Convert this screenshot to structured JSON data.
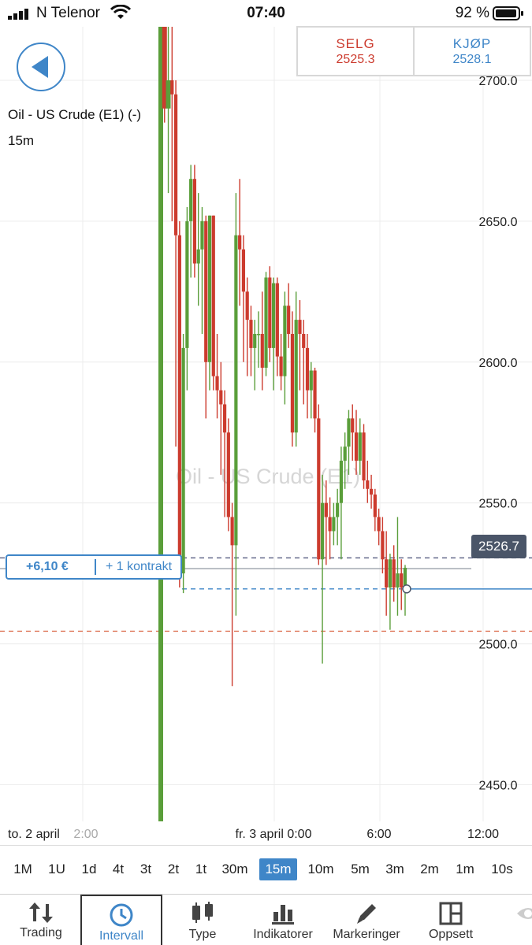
{
  "status_bar": {
    "carrier": "N Telenor",
    "time": "07:40",
    "battery_percent": "92 %"
  },
  "instrument": {
    "title": "Oil - US Crude (E1) (-)",
    "interval": "15m",
    "watermark": "Oil - US Crude (E1)"
  },
  "trade": {
    "sell_label": "SELG",
    "sell_price": "2525.3",
    "buy_label": "KJØP",
    "buy_price": "2528.1"
  },
  "position": {
    "pnl": "+6,10 €",
    "quantity": "+ 1 kontrakt"
  },
  "current_price_badge": "2526.7",
  "colors": {
    "accent": "#3f86c8",
    "up": "#5a9e3a",
    "down": "#cc3b2e",
    "badge": "#4a5568"
  },
  "chart_data": {
    "type": "candlestick",
    "y_ticks": [
      "2700.0",
      "2650.0",
      "2600.0",
      "2550.0",
      "2500.0",
      "2450.0"
    ],
    "y_tick_values": [
      2700,
      2650,
      2600,
      2550,
      2500,
      2450
    ],
    "x_labels": [
      "to. 2 april",
      "2:00",
      "fr. 3 april 0:00",
      "6:00",
      "12:00"
    ],
    "ylim": [
      2437,
      2719
    ],
    "reference_lines": {
      "current_price": 2526.7,
      "entry_price": 2519.5,
      "upper_dashed": 2530.5,
      "lower_dashed": 2504.5
    },
    "candles": [
      {
        "o": 2422,
        "h": 2719,
        "l": 2422,
        "c": 2719
      },
      {
        "o": 2719,
        "h": 2719,
        "l": 2685,
        "c": 2690
      },
      {
        "o": 2690,
        "h": 2719,
        "l": 2660,
        "c": 2700
      },
      {
        "o": 2700,
        "h": 2719,
        "l": 2650,
        "c": 2695
      },
      {
        "o": 2695,
        "h": 2700,
        "l": 2570,
        "c": 2645
      },
      {
        "o": 2645,
        "h": 2650,
        "l": 2520,
        "c": 2525
      },
      {
        "o": 2525,
        "h": 2610,
        "l": 2518,
        "c": 2605
      },
      {
        "o": 2605,
        "h": 2655,
        "l": 2590,
        "c": 2650
      },
      {
        "o": 2650,
        "h": 2670,
        "l": 2630,
        "c": 2665
      },
      {
        "o": 2665,
        "h": 2670,
        "l": 2630,
        "c": 2635
      },
      {
        "o": 2635,
        "h": 2660,
        "l": 2620,
        "c": 2640
      },
      {
        "o": 2640,
        "h": 2655,
        "l": 2610,
        "c": 2650
      },
      {
        "o": 2650,
        "h": 2652,
        "l": 2580,
        "c": 2600
      },
      {
        "o": 2600,
        "h": 2652,
        "l": 2590,
        "c": 2652
      },
      {
        "o": 2652,
        "h": 2652,
        "l": 2590,
        "c": 2595
      },
      {
        "o": 2595,
        "h": 2610,
        "l": 2580,
        "c": 2590
      },
      {
        "o": 2590,
        "h": 2600,
        "l": 2560,
        "c": 2585
      },
      {
        "o": 2585,
        "h": 2590,
        "l": 2545,
        "c": 2575
      },
      {
        "o": 2575,
        "h": 2580,
        "l": 2540,
        "c": 2545
      },
      {
        "o": 2545,
        "h": 2550,
        "l": 2485,
        "c": 2535
      },
      {
        "o": 2535,
        "h": 2660,
        "l": 2510,
        "c": 2645
      },
      {
        "o": 2645,
        "h": 2665,
        "l": 2620,
        "c": 2640
      },
      {
        "o": 2640,
        "h": 2645,
        "l": 2600,
        "c": 2625
      },
      {
        "o": 2625,
        "h": 2630,
        "l": 2595,
        "c": 2615
      },
      {
        "o": 2615,
        "h": 2620,
        "l": 2595,
        "c": 2605
      },
      {
        "o": 2605,
        "h": 2615,
        "l": 2590,
        "c": 2610
      },
      {
        "o": 2610,
        "h": 2618,
        "l": 2598,
        "c": 2610
      },
      {
        "o": 2610,
        "h": 2625,
        "l": 2590,
        "c": 2598
      },
      {
        "o": 2598,
        "h": 2632,
        "l": 2595,
        "c": 2630
      },
      {
        "o": 2630,
        "h": 2634,
        "l": 2600,
        "c": 2605
      },
      {
        "o": 2605,
        "h": 2630,
        "l": 2590,
        "c": 2628
      },
      {
        "o": 2628,
        "h": 2630,
        "l": 2595,
        "c": 2602
      },
      {
        "o": 2602,
        "h": 2610,
        "l": 2590,
        "c": 2595
      },
      {
        "o": 2595,
        "h": 2625,
        "l": 2585,
        "c": 2620
      },
      {
        "o": 2620,
        "h": 2628,
        "l": 2605,
        "c": 2610
      },
      {
        "o": 2610,
        "h": 2618,
        "l": 2570,
        "c": 2575
      },
      {
        "o": 2575,
        "h": 2625,
        "l": 2570,
        "c": 2615
      },
      {
        "o": 2615,
        "h": 2622,
        "l": 2590,
        "c": 2610
      },
      {
        "o": 2610,
        "h": 2615,
        "l": 2585,
        "c": 2605
      },
      {
        "o": 2605,
        "h": 2610,
        "l": 2580,
        "c": 2590
      },
      {
        "o": 2590,
        "h": 2600,
        "l": 2580,
        "c": 2597
      },
      {
        "o": 2597,
        "h": 2598,
        "l": 2575,
        "c": 2580
      },
      {
        "o": 2580,
        "h": 2585,
        "l": 2528,
        "c": 2530
      },
      {
        "o": 2530,
        "h": 2560,
        "l": 2493,
        "c": 2550
      },
      {
        "o": 2550,
        "h": 2558,
        "l": 2528,
        "c": 2545
      },
      {
        "o": 2545,
        "h": 2552,
        "l": 2530,
        "c": 2540
      },
      {
        "o": 2540,
        "h": 2550,
        "l": 2535,
        "c": 2545
      },
      {
        "o": 2545,
        "h": 2555,
        "l": 2535,
        "c": 2550
      },
      {
        "o": 2550,
        "h": 2570,
        "l": 2530,
        "c": 2565
      },
      {
        "o": 2565,
        "h": 2575,
        "l": 2555,
        "c": 2570
      },
      {
        "o": 2570,
        "h": 2583,
        "l": 2560,
        "c": 2580
      },
      {
        "o": 2580,
        "h": 2585,
        "l": 2565,
        "c": 2575
      },
      {
        "o": 2575,
        "h": 2583,
        "l": 2560,
        "c": 2565
      },
      {
        "o": 2565,
        "h": 2580,
        "l": 2560,
        "c": 2575
      },
      {
        "o": 2575,
        "h": 2578,
        "l": 2555,
        "c": 2558
      },
      {
        "o": 2558,
        "h": 2565,
        "l": 2550,
        "c": 2555
      },
      {
        "o": 2555,
        "h": 2560,
        "l": 2548,
        "c": 2553
      },
      {
        "o": 2553,
        "h": 2555,
        "l": 2540,
        "c": 2545
      },
      {
        "o": 2545,
        "h": 2548,
        "l": 2535,
        "c": 2540
      },
      {
        "o": 2540,
        "h": 2545,
        "l": 2525,
        "c": 2530
      },
      {
        "o": 2530,
        "h": 2540,
        "l": 2510,
        "c": 2520
      },
      {
        "o": 2520,
        "h": 2532,
        "l": 2505,
        "c": 2530
      },
      {
        "o": 2530,
        "h": 2535,
        "l": 2515,
        "c": 2520
      },
      {
        "o": 2520,
        "h": 2545,
        "l": 2510,
        "c": 2525
      },
      {
        "o": 2525,
        "h": 2530,
        "l": 2512,
        "c": 2520
      },
      {
        "o": 2520,
        "h": 2528,
        "l": 2510,
        "c": 2527
      }
    ]
  },
  "intervals": {
    "items": [
      "1M",
      "1U",
      "1d",
      "4t",
      "3t",
      "2t",
      "1t",
      "30m",
      "15m",
      "10m",
      "5m",
      "3m",
      "2m",
      "1m",
      "10s"
    ],
    "selected": "15m"
  },
  "tabs": [
    {
      "label": "Trading",
      "icon": "swap-arrows-icon"
    },
    {
      "label": "Intervall",
      "icon": "clock-icon"
    },
    {
      "label": "Type",
      "icon": "candles-icon"
    },
    {
      "label": "Indikatorer",
      "icon": "bar-chart-icon"
    },
    {
      "label": "Markeringer",
      "icon": "pencil-icon"
    },
    {
      "label": "Oppsett",
      "icon": "layout-icon"
    }
  ]
}
